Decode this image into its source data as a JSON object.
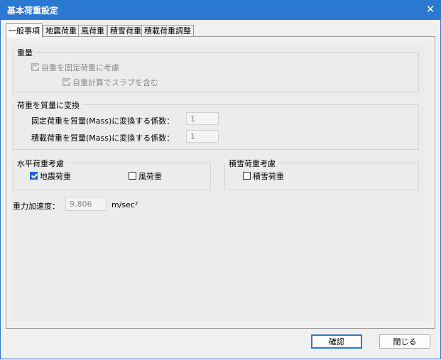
{
  "window": {
    "title": "基本荷重設定",
    "close_icon": "close-icon"
  },
  "tabs": [
    {
      "label": "一般事項",
      "active": true
    },
    {
      "label": "地震荷重",
      "active": false
    },
    {
      "label": "風荷重",
      "active": false
    },
    {
      "label": "積雪荷重",
      "active": false
    },
    {
      "label": "積載荷重調整",
      "active": false
    }
  ],
  "weight_group": {
    "title": "重量",
    "self_weight_label": "自重を固定荷重に考慮",
    "self_weight_checked": true,
    "slab_label": "自重計算でスラブを含む",
    "slab_checked": true
  },
  "mass_group": {
    "title": "荷重を質量に変換",
    "dead_label": "固定荷重を質量(Mass)に変換する係数：",
    "dead_value": "1",
    "live_label": "積載荷重を質量(Mass)に変換する係数：",
    "live_value": "1"
  },
  "horizontal_group": {
    "title": "水平荷重考慮",
    "seismic_label": "地震荷重",
    "seismic_checked": true,
    "wind_label": "風荷重",
    "wind_checked": false
  },
  "snow_group": {
    "title": "積雪荷重考慮",
    "snow_label": "積雪荷重",
    "snow_checked": false
  },
  "gravity": {
    "label": "重力加速度：",
    "value": "9.806",
    "unit": "m/sec²"
  },
  "buttons": {
    "ok": "確認",
    "close": "閉じる"
  },
  "colors": {
    "titlebar": "#2b78d0",
    "check_accent": "#1e64c8"
  }
}
